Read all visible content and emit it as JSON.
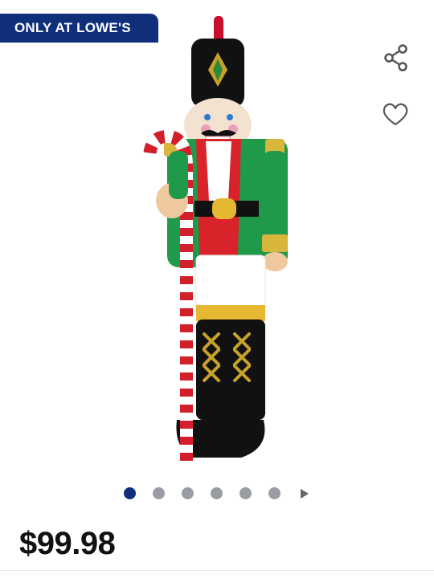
{
  "badge": {
    "label": "ONLY AT LOWE'S"
  },
  "actions": {
    "share_icon": "share-icon",
    "favorite_icon": "heart-outline-icon"
  },
  "gallery": {
    "image_count": 6,
    "active_index": 0,
    "next_icon": "triangle-right-icon"
  },
  "product": {
    "price": "$99.98"
  },
  "colors": {
    "brand_navy": "#0f2f7a",
    "dot_inactive": "#9a9ca3",
    "price_text": "#111111"
  }
}
